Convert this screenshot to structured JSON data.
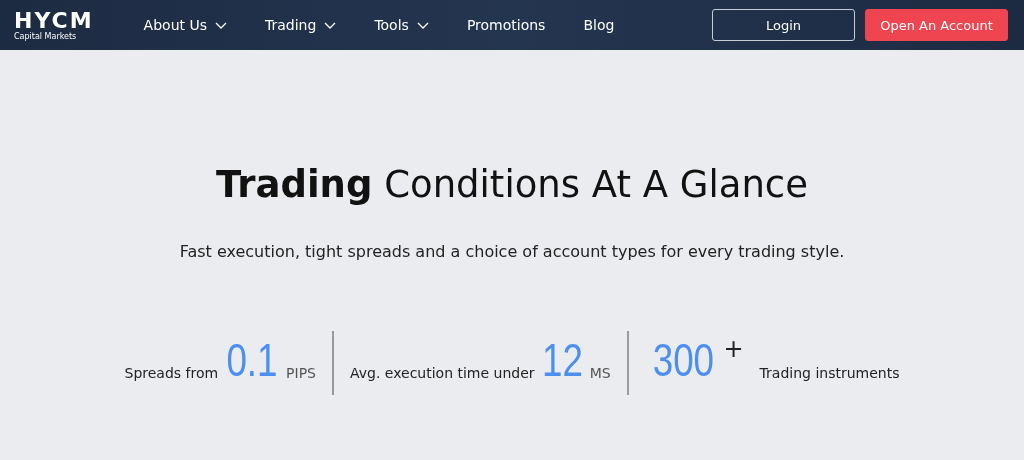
{
  "header": {
    "logo": {
      "name": "HYCM",
      "tagline": "Capital Markets"
    },
    "nav": [
      {
        "label": "About Us",
        "dropdown": true
      },
      {
        "label": "Trading",
        "dropdown": true
      },
      {
        "label": "Tools",
        "dropdown": true
      },
      {
        "label": "Promotions",
        "dropdown": false
      },
      {
        "label": "Blog",
        "dropdown": false
      }
    ],
    "buttons": [
      {
        "label": "Login",
        "kind": "outline"
      },
      {
        "label": "Open An Account",
        "kind": "primary"
      }
    ]
  },
  "hero": {
    "title": "**Trading** Conditions At A Glance",
    "subtitle": "Fast execution, tight spreads and a choice of account types for every trading style."
  },
  "stats": [
    {
      "before": "Spreads from",
      "value": "0.1",
      "unit": "PIPS"
    },
    {
      "before": "Avg. execution time under",
      "value": "12",
      "unit": "MS"
    },
    {
      "value": "300",
      "unit": "+",
      "after": "Trading instruments"
    }
  ]
}
